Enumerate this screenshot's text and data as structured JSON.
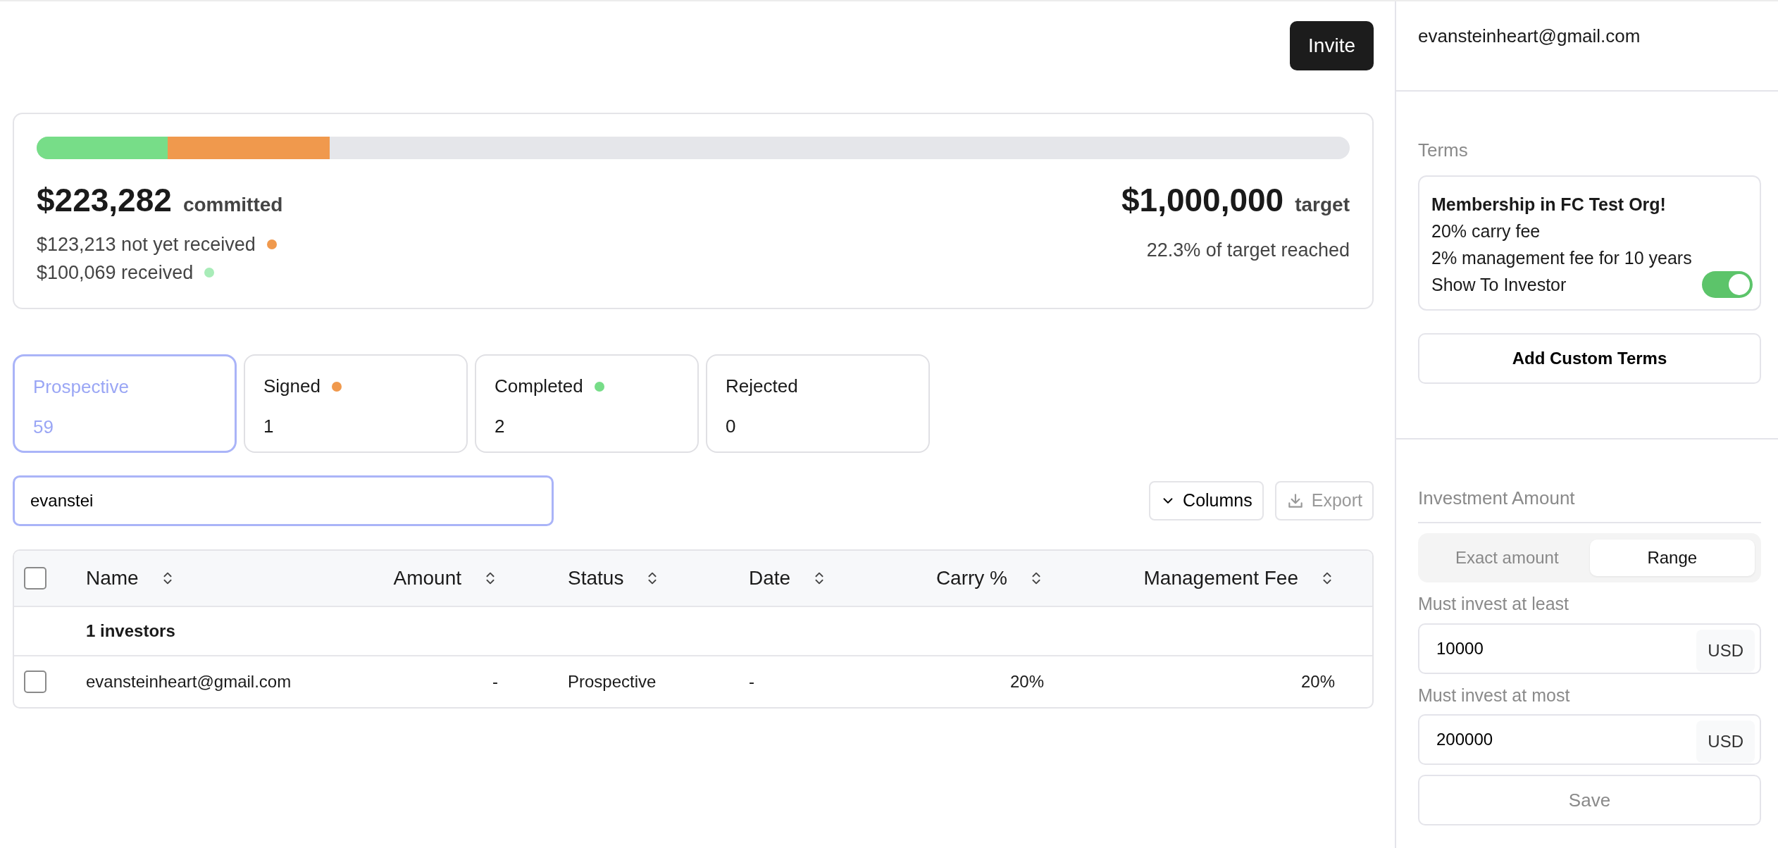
{
  "header": {
    "invite_button": "Invite"
  },
  "summary": {
    "bar": [
      {
        "level": 0.1,
        "color": "#77dd88"
      },
      {
        "level": 0.123,
        "color": "#f0994d"
      }
    ],
    "committed_amount": "$223,282",
    "committed_label": "committed",
    "breakdown": [
      {
        "text": "$123,213 not yet received",
        "color": "#f0994d"
      },
      {
        "text": "$100,069 received",
        "color": "#a8ecb8"
      }
    ],
    "target_amount": "$1,000,000",
    "target_label": "target",
    "target_progress": "22.3% of target reached"
  },
  "status_tabs": [
    {
      "label": "Prospective",
      "count": "59",
      "selected": true
    },
    {
      "label": "Signed",
      "count": "1",
      "selected": false,
      "color": "#f0994d"
    },
    {
      "label": "Completed",
      "count": "2",
      "selected": false,
      "color": "#77dd88"
    },
    {
      "label": "Rejected",
      "count": "0",
      "selected": false
    }
  ],
  "search": {
    "value": "evanstei"
  },
  "toolbar": {
    "columns_button": "Columns",
    "export_button": {
      "label": "Export",
      "disabled": true
    }
  },
  "table": {
    "header_checkbox": {
      "checked": false
    },
    "columns": [
      {
        "label": "Name"
      },
      {
        "label": "Amount"
      },
      {
        "label": "Status"
      },
      {
        "label": "Date"
      },
      {
        "label": "Carry %"
      },
      {
        "label": "Management Fee"
      }
    ],
    "group_label": "1 investors",
    "rows": [
      {
        "checked": false,
        "cells": [
          "evansteinheart@gmail.com",
          "-",
          "Prospective",
          "-",
          "20%",
          "20%"
        ]
      }
    ]
  },
  "sidebar": {
    "investor_email": "evansteinheart@gmail.com",
    "terms_heading": "Terms",
    "terms_card": {
      "title": "Membership in FC Test Org!",
      "lines": [
        "20% carry fee",
        "2% management fee for 10 years"
      ],
      "toggle_label": "Show To Investor",
      "toggle_on": true
    },
    "add_terms_button": "Add Custom Terms",
    "investment_heading": "Investment Amount",
    "amount_mode": [
      {
        "label": "Exact amount",
        "selected": false
      },
      {
        "label": "Range",
        "selected": true
      }
    ],
    "fields": [
      {
        "label": "Must invest at least",
        "value": "10000",
        "unit": "USD"
      },
      {
        "label": "Must invest at most",
        "value": "200000",
        "unit": "USD"
      }
    ],
    "save_button": {
      "label": "Save",
      "disabled": true
    }
  }
}
